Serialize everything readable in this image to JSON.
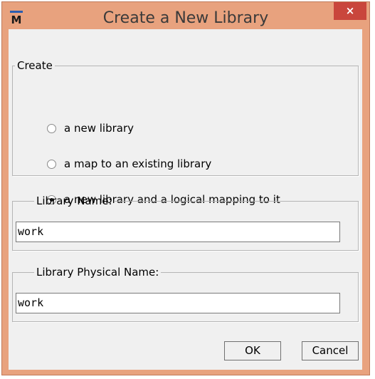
{
  "window": {
    "title": "Create a New Library",
    "app_icon": "modelsim-icon",
    "close_label": "×",
    "colors": {
      "frame": "#e8a27e",
      "close": "#c9463c",
      "client": "#f0f0f0"
    }
  },
  "create_group": {
    "legend": "Create",
    "options": [
      {
        "label": "a new library",
        "checked": false
      },
      {
        "label": "a map to an existing library",
        "checked": false
      },
      {
        "label": "a new library and a logical mapping to it",
        "checked": true
      }
    ]
  },
  "library_name": {
    "legend": "Library Name:",
    "value": "work"
  },
  "library_physical_name": {
    "legend": "Library Physical Name:",
    "value": "work"
  },
  "buttons": {
    "ok": "OK",
    "cancel": "Cancel"
  }
}
